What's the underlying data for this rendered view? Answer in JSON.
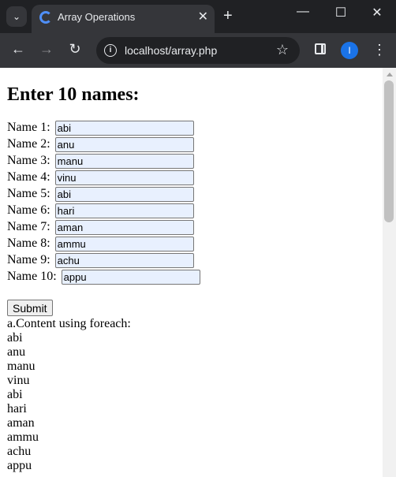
{
  "browser": {
    "tab_title": "Array Operations",
    "url": "localhost/array.php",
    "profile_initial": "I"
  },
  "page": {
    "heading": "Enter 10 names:",
    "fields": [
      {
        "label": "Name 1:",
        "value": "abi"
      },
      {
        "label": "Name 2:",
        "value": "anu"
      },
      {
        "label": "Name 3:",
        "value": "manu"
      },
      {
        "label": "Name 4:",
        "value": "vinu"
      },
      {
        "label": "Name 5:",
        "value": "abi"
      },
      {
        "label": "Name 6:",
        "value": "hari"
      },
      {
        "label": "Name 7:",
        "value": "aman"
      },
      {
        "label": "Name 8:",
        "value": "ammu"
      },
      {
        "label": "Name 9:",
        "value": "achu"
      },
      {
        "label": "Name 10:",
        "value": "appu"
      }
    ],
    "submit_label": "Submit",
    "output_heading": "a.Content using foreach:",
    "output": [
      "abi",
      "anu",
      "manu",
      "vinu",
      "abi",
      "hari",
      "aman",
      "ammu",
      "achu",
      "appu"
    ]
  }
}
